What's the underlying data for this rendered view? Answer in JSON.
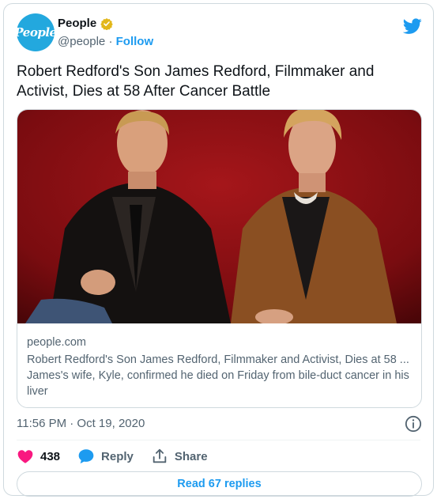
{
  "account": {
    "avatar_text": "People",
    "name": "People",
    "handle": "@people",
    "separator": "·",
    "follow_label": "Follow"
  },
  "tweet": {
    "text": "Robert Redford's Son James Redford, Filmmaker and Activist, Dies at 58 After Cancer Battle",
    "timestamp": "11:56 PM · Oct 19, 2020"
  },
  "link_card": {
    "domain": "people.com",
    "title": "Robert Redford's Son James Redford, Filmmaker and Activist, Dies at 58 ...",
    "description": "James's wife, Kyle, confirmed he died on Friday from bile-duct cancer in his liver"
  },
  "actions": {
    "like_count": "438",
    "reply_label": "Reply",
    "share_label": "Share"
  },
  "replies_button": "Read 67 replies",
  "colors": {
    "brand_blue": "#1d9bf0",
    "like_pink": "#f91880",
    "verified_gold": "#e2b719",
    "avatar_blue": "#23a8de"
  },
  "icons": [
    "twitter-bird-icon",
    "verified-badge-icon",
    "info-icon",
    "heart-icon",
    "reply-bubble-icon",
    "share-icon"
  ]
}
